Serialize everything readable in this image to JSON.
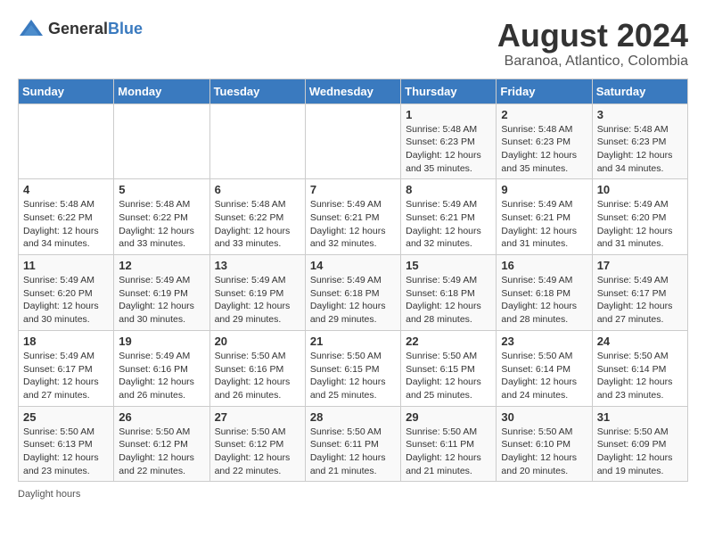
{
  "header": {
    "logo_general": "General",
    "logo_blue": "Blue",
    "title": "August 2024",
    "subtitle": "Baranoa, Atlantico, Colombia"
  },
  "days_of_week": [
    "Sunday",
    "Monday",
    "Tuesday",
    "Wednesday",
    "Thursday",
    "Friday",
    "Saturday"
  ],
  "weeks": [
    [
      {
        "date": "",
        "info": ""
      },
      {
        "date": "",
        "info": ""
      },
      {
        "date": "",
        "info": ""
      },
      {
        "date": "",
        "info": ""
      },
      {
        "date": "1",
        "info": "Sunrise: 5:48 AM\nSunset: 6:23 PM\nDaylight: 12 hours and 35 minutes."
      },
      {
        "date": "2",
        "info": "Sunrise: 5:48 AM\nSunset: 6:23 PM\nDaylight: 12 hours and 35 minutes."
      },
      {
        "date": "3",
        "info": "Sunrise: 5:48 AM\nSunset: 6:23 PM\nDaylight: 12 hours and 34 minutes."
      }
    ],
    [
      {
        "date": "4",
        "info": "Sunrise: 5:48 AM\nSunset: 6:22 PM\nDaylight: 12 hours and 34 minutes."
      },
      {
        "date": "5",
        "info": "Sunrise: 5:48 AM\nSunset: 6:22 PM\nDaylight: 12 hours and 33 minutes."
      },
      {
        "date": "6",
        "info": "Sunrise: 5:48 AM\nSunset: 6:22 PM\nDaylight: 12 hours and 33 minutes."
      },
      {
        "date": "7",
        "info": "Sunrise: 5:49 AM\nSunset: 6:21 PM\nDaylight: 12 hours and 32 minutes."
      },
      {
        "date": "8",
        "info": "Sunrise: 5:49 AM\nSunset: 6:21 PM\nDaylight: 12 hours and 32 minutes."
      },
      {
        "date": "9",
        "info": "Sunrise: 5:49 AM\nSunset: 6:21 PM\nDaylight: 12 hours and 31 minutes."
      },
      {
        "date": "10",
        "info": "Sunrise: 5:49 AM\nSunset: 6:20 PM\nDaylight: 12 hours and 31 minutes."
      }
    ],
    [
      {
        "date": "11",
        "info": "Sunrise: 5:49 AM\nSunset: 6:20 PM\nDaylight: 12 hours and 30 minutes."
      },
      {
        "date": "12",
        "info": "Sunrise: 5:49 AM\nSunset: 6:19 PM\nDaylight: 12 hours and 30 minutes."
      },
      {
        "date": "13",
        "info": "Sunrise: 5:49 AM\nSunset: 6:19 PM\nDaylight: 12 hours and 29 minutes."
      },
      {
        "date": "14",
        "info": "Sunrise: 5:49 AM\nSunset: 6:18 PM\nDaylight: 12 hours and 29 minutes."
      },
      {
        "date": "15",
        "info": "Sunrise: 5:49 AM\nSunset: 6:18 PM\nDaylight: 12 hours and 28 minutes."
      },
      {
        "date": "16",
        "info": "Sunrise: 5:49 AM\nSunset: 6:18 PM\nDaylight: 12 hours and 28 minutes."
      },
      {
        "date": "17",
        "info": "Sunrise: 5:49 AM\nSunset: 6:17 PM\nDaylight: 12 hours and 27 minutes."
      }
    ],
    [
      {
        "date": "18",
        "info": "Sunrise: 5:49 AM\nSunset: 6:17 PM\nDaylight: 12 hours and 27 minutes."
      },
      {
        "date": "19",
        "info": "Sunrise: 5:49 AM\nSunset: 6:16 PM\nDaylight: 12 hours and 26 minutes."
      },
      {
        "date": "20",
        "info": "Sunrise: 5:50 AM\nSunset: 6:16 PM\nDaylight: 12 hours and 26 minutes."
      },
      {
        "date": "21",
        "info": "Sunrise: 5:50 AM\nSunset: 6:15 PM\nDaylight: 12 hours and 25 minutes."
      },
      {
        "date": "22",
        "info": "Sunrise: 5:50 AM\nSunset: 6:15 PM\nDaylight: 12 hours and 25 minutes."
      },
      {
        "date": "23",
        "info": "Sunrise: 5:50 AM\nSunset: 6:14 PM\nDaylight: 12 hours and 24 minutes."
      },
      {
        "date": "24",
        "info": "Sunrise: 5:50 AM\nSunset: 6:14 PM\nDaylight: 12 hours and 23 minutes."
      }
    ],
    [
      {
        "date": "25",
        "info": "Sunrise: 5:50 AM\nSunset: 6:13 PM\nDaylight: 12 hours and 23 minutes."
      },
      {
        "date": "26",
        "info": "Sunrise: 5:50 AM\nSunset: 6:12 PM\nDaylight: 12 hours and 22 minutes."
      },
      {
        "date": "27",
        "info": "Sunrise: 5:50 AM\nSunset: 6:12 PM\nDaylight: 12 hours and 22 minutes."
      },
      {
        "date": "28",
        "info": "Sunrise: 5:50 AM\nSunset: 6:11 PM\nDaylight: 12 hours and 21 minutes."
      },
      {
        "date": "29",
        "info": "Sunrise: 5:50 AM\nSunset: 6:11 PM\nDaylight: 12 hours and 21 minutes."
      },
      {
        "date": "30",
        "info": "Sunrise: 5:50 AM\nSunset: 6:10 PM\nDaylight: 12 hours and 20 minutes."
      },
      {
        "date": "31",
        "info": "Sunrise: 5:50 AM\nSunset: 6:09 PM\nDaylight: 12 hours and 19 minutes."
      }
    ]
  ],
  "footer": "Daylight hours"
}
